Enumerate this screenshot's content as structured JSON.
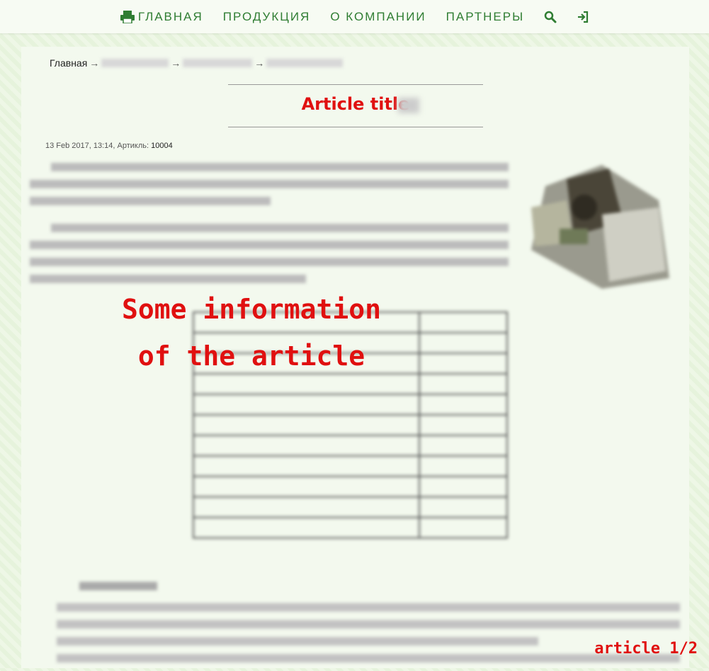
{
  "nav": {
    "items": [
      {
        "label": "ГЛАВНАЯ"
      },
      {
        "label": "ПРОДУКЦИЯ"
      },
      {
        "label": "О КОМПАНИИ"
      },
      {
        "label": "ПАРТНЕРЫ"
      }
    ],
    "icons": [
      "printer-icon",
      "search-icon",
      "login-icon"
    ],
    "accent": "#2f7d32"
  },
  "breadcrumb": {
    "home": "Главная",
    "separator": "→"
  },
  "article": {
    "title": "Article title",
    "date": "13 Feb 2017, 13:14,",
    "sku_label": "Артикль:",
    "sku_value": "10004",
    "overlay_text": "Some information of the article"
  },
  "footer": {
    "page_indicator": "article 1/2"
  },
  "colors": {
    "overlay": "#e01010",
    "background": "#eef7e6"
  }
}
